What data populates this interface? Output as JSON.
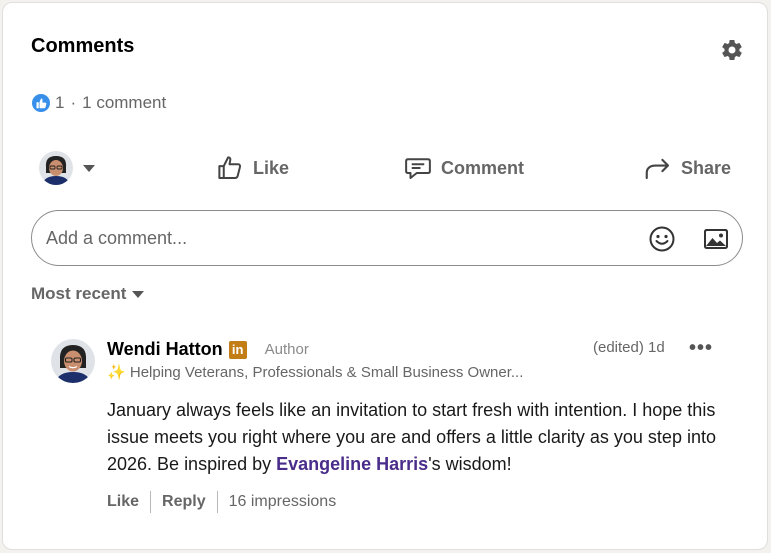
{
  "header": {
    "title": "Comments",
    "settings_icon": "gear-icon"
  },
  "reactions": {
    "icon": "like-icon",
    "count": "1",
    "separator": "·",
    "comments_label": "1 comment"
  },
  "actions": {
    "like_label": "Like",
    "comment_label": "Comment",
    "share_label": "Share"
  },
  "composer": {
    "placeholder": "Add a comment...",
    "emoji_icon": "emoji-icon",
    "image_icon": "image-icon"
  },
  "sort": {
    "label": "Most recent"
  },
  "comment": {
    "author": "Wendi Hatton",
    "badge": "in",
    "role": "Author",
    "edited": "(edited)",
    "time": "1d",
    "more": "•••",
    "headline_emoji": "✨",
    "headline": "Helping Veterans, Professionals & Small Business Owner...",
    "body_before": "January always feels like an invitation to start fresh with intention. I hope this issue meets you right where you are and offers a little clarity as you step into 2026. Be inspired by ",
    "mention": "Evangeline Harris",
    "body_after": "'s wisdom!",
    "like_label": "Like",
    "reply_label": "Reply",
    "impressions": "16 impressions"
  },
  "colors": {
    "accent_blue": "#378fe9",
    "mention": "#4a2d8a",
    "badge": "#c37d16"
  }
}
